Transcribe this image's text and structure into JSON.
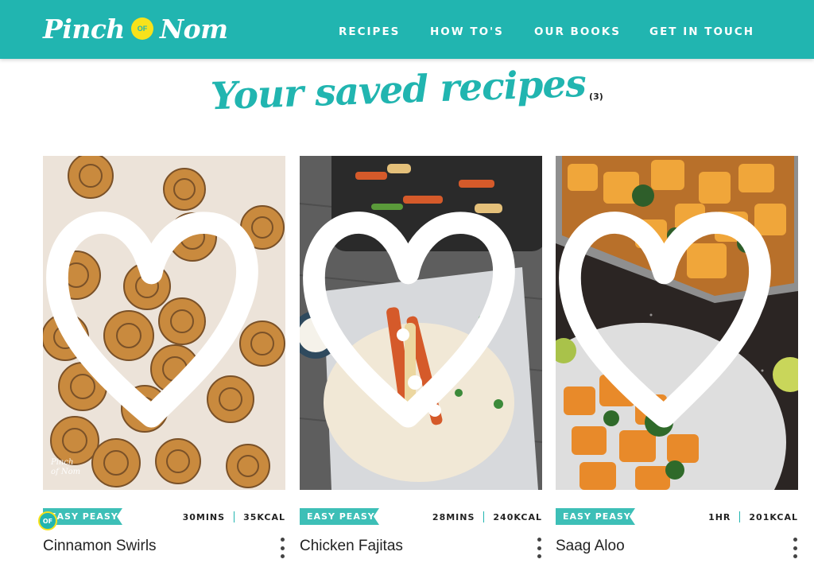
{
  "brand": {
    "logo_left": "Pinch",
    "logo_badge": "OF",
    "logo_right": "Nom",
    "primary_color": "#21b5b0",
    "badge_color": "#f7e21b"
  },
  "nav": {
    "items": [
      "RECIPES",
      "HOW TO'S",
      "OUR BOOKS",
      "GET IN TOUCH"
    ]
  },
  "page": {
    "title": "Your saved recipes",
    "count": "(3)"
  },
  "recipes": [
    {
      "name": "Cinnamon Swirls",
      "tag": "EASY PEASY",
      "time": "30MINS",
      "calories": "35KCAL",
      "image_icon": "cinnamon-swirls-photo",
      "watermark": "Pinch of Nom"
    },
    {
      "name": "Chicken Fajitas",
      "tag": "EASY PEASY",
      "time": "28MINS",
      "calories": "240KCAL",
      "image_icon": "chicken-fajitas-photo"
    },
    {
      "name": "Saag Aloo",
      "tag": "EASY PEASY",
      "time": "1HR",
      "calories": "201KCAL",
      "image_icon": "saag-aloo-photo"
    }
  ],
  "floating_badge": "OF"
}
